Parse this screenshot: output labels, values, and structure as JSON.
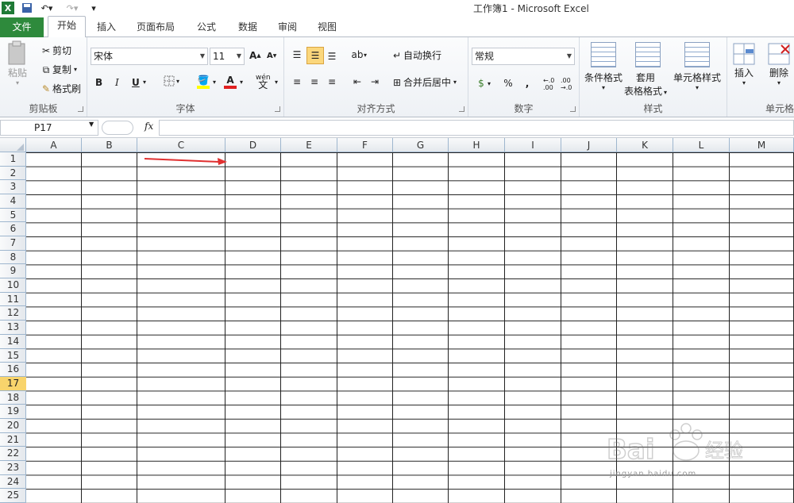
{
  "title": "工作簿1 - Microsoft Excel",
  "tabs": [
    "文件",
    "开始",
    "插入",
    "页面布局",
    "公式",
    "数据",
    "审阅",
    "视图"
  ],
  "ribbon": {
    "clipboard": {
      "paste": "粘贴",
      "cut": "剪切",
      "copy": "复制",
      "format_painter": "格式刷",
      "label": "剪贴板"
    },
    "font": {
      "name": "宋体",
      "size": "11",
      "bold": "B",
      "italic": "I",
      "underline": "U",
      "label": "字体"
    },
    "alignment": {
      "wrap": "自动换行",
      "merge": "合并后居中",
      "label": "对齐方式"
    },
    "number": {
      "format": "常规",
      "label": "数字"
    },
    "styles": {
      "conditional": "条件格式",
      "table_a": "套用",
      "table_b": "表格格式",
      "cell_styles": "单元格样式",
      "label": "样式"
    },
    "cells": {
      "insert": "插入",
      "delete": "删除",
      "label": "单元格"
    }
  },
  "namebox": "P17",
  "fx": "fx",
  "columns": [
    "A",
    "B",
    "C",
    "D",
    "E",
    "F",
    "G",
    "H",
    "I",
    "J",
    "K",
    "L",
    "M"
  ],
  "rows": [
    "1",
    "2",
    "3",
    "4",
    "5",
    "6",
    "7",
    "8",
    "9",
    "10",
    "11",
    "12",
    "13",
    "14",
    "15",
    "16",
    "17",
    "18",
    "19",
    "20",
    "21",
    "22",
    "23",
    "24",
    "25"
  ],
  "selected_row": "17",
  "watermark": "jingyan.baidu.com",
  "colors": {
    "file_tab": "#2e8a3c",
    "selected_row": "#f8d46c",
    "arrow": "#e03030"
  }
}
